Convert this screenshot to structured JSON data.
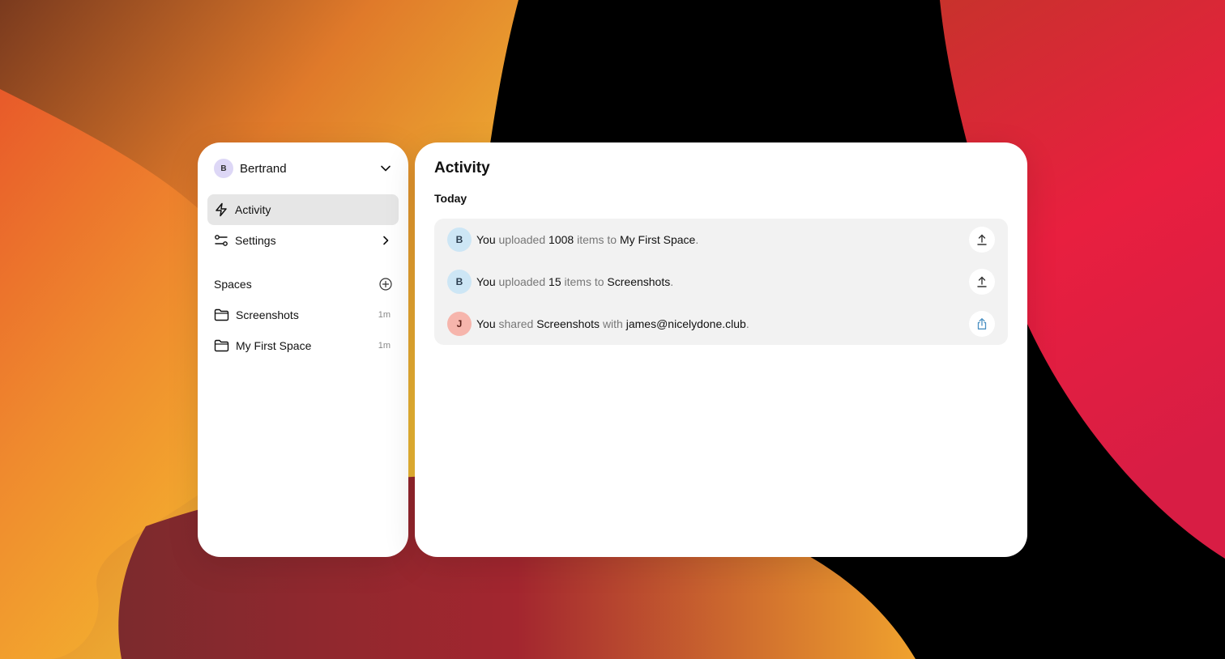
{
  "sidebar": {
    "user": {
      "initial": "B",
      "name": "Bertrand"
    },
    "nav": [
      {
        "label": "Activity",
        "icon": "bolt-icon",
        "active": true
      },
      {
        "label": "Settings",
        "icon": "sliders-icon",
        "active": false
      }
    ],
    "spaces_label": "Spaces",
    "spaces": [
      {
        "label": "Screenshots",
        "time": "1m",
        "icon": "folder-icon"
      },
      {
        "label": "My First Space",
        "time": "1m",
        "icon": "folder-icon"
      }
    ]
  },
  "main": {
    "title": "Activity",
    "section": "Today",
    "activities": [
      {
        "initial": "B",
        "actor": "You",
        "verb": "uploaded",
        "count": "1008",
        "mid": "items to",
        "target": "My First Space",
        "end": ".",
        "action_icon": "upload-icon"
      },
      {
        "initial": "B",
        "actor": "You",
        "verb": "uploaded",
        "count": "15",
        "mid": "items to",
        "target": "Screenshots",
        "end": ".",
        "action_icon": "upload-icon"
      },
      {
        "initial": "J",
        "actor": "You",
        "verb": "shared",
        "target": "Screenshots",
        "mid": "with",
        "recipient": "james@nicelydone.club",
        "end": ".",
        "action_icon": "share-icon"
      }
    ]
  },
  "colors": {
    "nav_active_bg": "#e6e6e6",
    "activity_bg": "#f2f2f2",
    "avatar_blue": "#cde6f5",
    "avatar_red": "#f6b5ac",
    "share_icon": "#4a90c2"
  }
}
